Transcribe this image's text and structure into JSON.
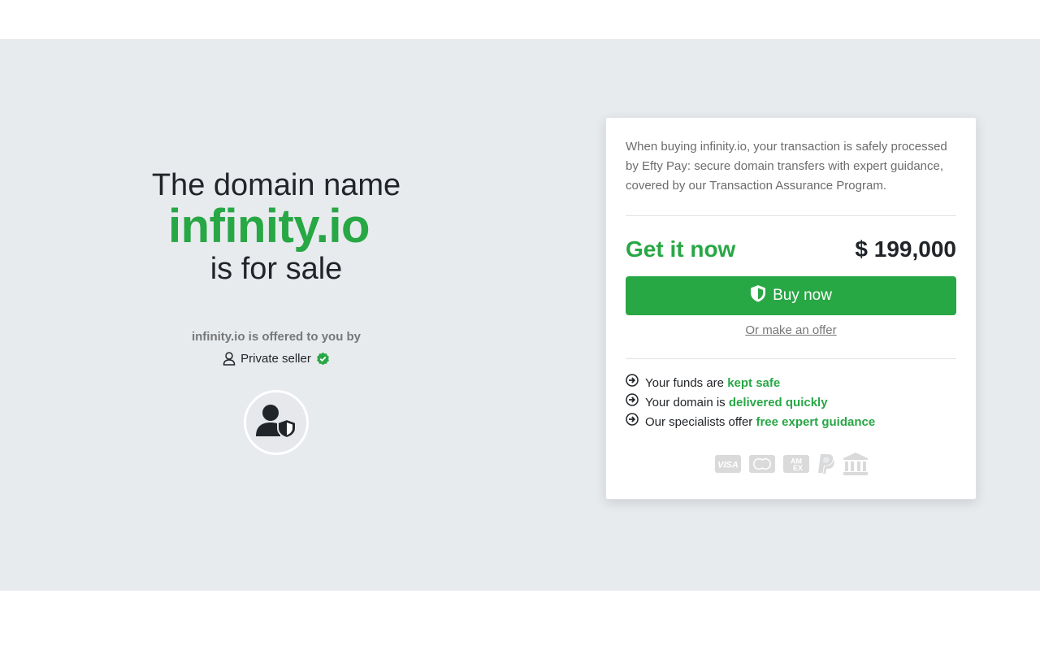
{
  "hero": {
    "line1": "The domain name",
    "domain": "infinity.io",
    "line3": "is for sale",
    "offered_by": "infinity.io is offered to you by",
    "seller_label": "Private seller"
  },
  "card": {
    "description": "When buying infinity.io, your transaction is safely processed by Efty Pay: secure domain transfers with expert guidance, covered by our Transaction Assurance Program.",
    "get_it_now": "Get it now",
    "price": "$ 199,000",
    "buy_now": "Buy now",
    "make_offer": "Or make an offer",
    "features": [
      {
        "prefix": "Your funds are ",
        "highlight": "kept safe"
      },
      {
        "prefix": "Your domain is ",
        "highlight": "delivered quickly"
      },
      {
        "prefix": "Our specialists offer ",
        "highlight": "free expert guidance"
      }
    ],
    "payment_methods": [
      "visa-icon",
      "mastercard-icon",
      "amex-icon",
      "paypal-icon",
      "bank-icon"
    ]
  },
  "colors": {
    "accent": "#28a745",
    "hero_bg": "#e8ebee",
    "text": "#212529",
    "muted": "#777777"
  }
}
